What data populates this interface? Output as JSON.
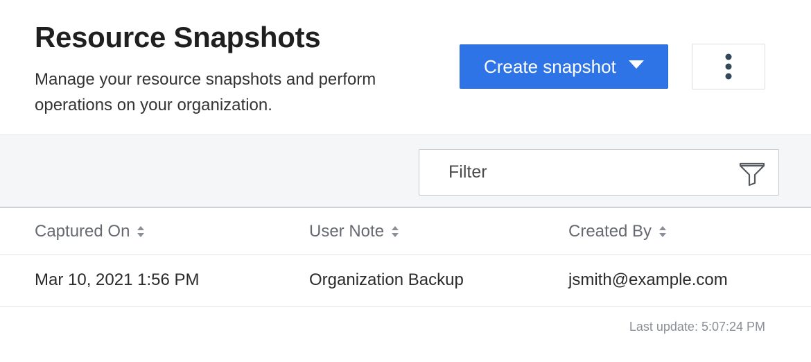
{
  "header": {
    "title": "Resource Snapshots",
    "subtitle": "Manage your resource snapshots and perform operations on your organization.",
    "create_button_label": "Create snapshot",
    "create_button_icon": "caret-down-icon",
    "more_button_icon": "vertical-ellipsis-icon"
  },
  "toolbar": {
    "filter_placeholder": "Filter",
    "filter_value": "",
    "filter_icon": "funnel-icon"
  },
  "table": {
    "columns": [
      {
        "label": "Captured On",
        "sort_icon": "sort-icon"
      },
      {
        "label": "User Note",
        "sort_icon": "sort-icon"
      },
      {
        "label": "Created By",
        "sort_icon": "sort-icon"
      }
    ],
    "rows": [
      {
        "captured_on": "Mar 10, 2021 1:56 PM",
        "user_note": "Organization Backup",
        "created_by": "jsmith@example.com"
      }
    ]
  },
  "footer": {
    "last_update": "Last update: 5:07:24 PM"
  },
  "colors": {
    "accent": "#2f74e6",
    "toolbar_bg": "#f4f6f8",
    "header_text": "#666a70"
  }
}
